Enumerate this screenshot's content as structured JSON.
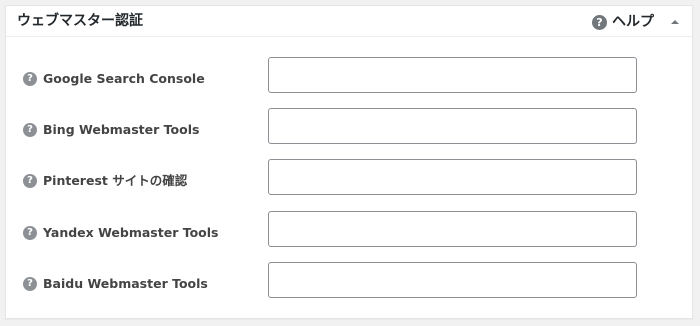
{
  "postbox": {
    "title": "ウェブマスター認証",
    "help_label": "ヘルプ",
    "help_icon": "question-circle-icon",
    "collapse_icon": "triangle-up-icon"
  },
  "fields": [
    {
      "label": "Google Search Console",
      "value": "",
      "icon": "question-circle-icon"
    },
    {
      "label": "Bing Webmaster Tools",
      "value": "",
      "icon": "question-circle-icon"
    },
    {
      "label": "Pinterest サイトの確認",
      "value": "",
      "icon": "question-circle-icon"
    },
    {
      "label": "Yandex Webmaster Tools",
      "value": "",
      "icon": "question-circle-icon"
    },
    {
      "label": "Baidu Webmaster Tools",
      "value": "",
      "icon": "question-circle-icon"
    }
  ],
  "colors": {
    "page_bg": "#f1f1f1",
    "panel_bg": "#ffffff",
    "help_icon": "#72777c",
    "row_icon": "#8d9196",
    "input_border": "#8c8f94"
  }
}
